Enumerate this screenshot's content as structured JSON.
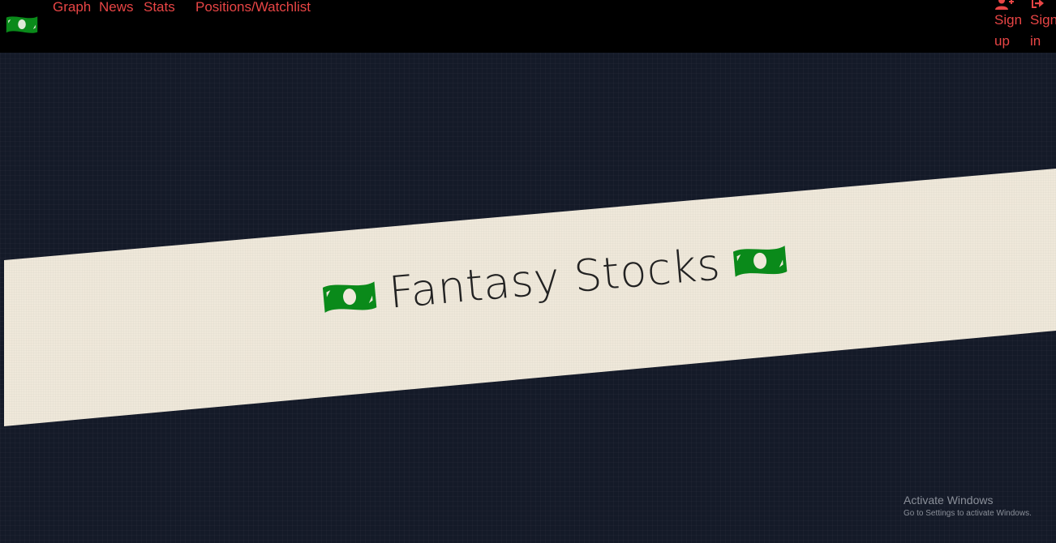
{
  "nav": {
    "logo_icon": "money-bill-icon",
    "links": [
      "Graph",
      "News",
      "Stats",
      "Positions/Watchlist"
    ],
    "signup": {
      "icon": "user-plus-icon",
      "line1": "Sign",
      "line2": "up"
    },
    "signin": {
      "icon": "sign-in-icon",
      "line1": "Sign",
      "line2": "in"
    }
  },
  "hero": {
    "title": "Fantasy Stocks",
    "icon": "money-bill-icon"
  },
  "watermark": {
    "title": "Activate Windows",
    "subtitle": "Go to Settings to activate Windows."
  },
  "colors": {
    "navbar_bg": "#000000",
    "link": "#e84545",
    "page_bg": "#141a28",
    "banner_bg": "#efe8da",
    "money_green": "#0a8a1a"
  }
}
